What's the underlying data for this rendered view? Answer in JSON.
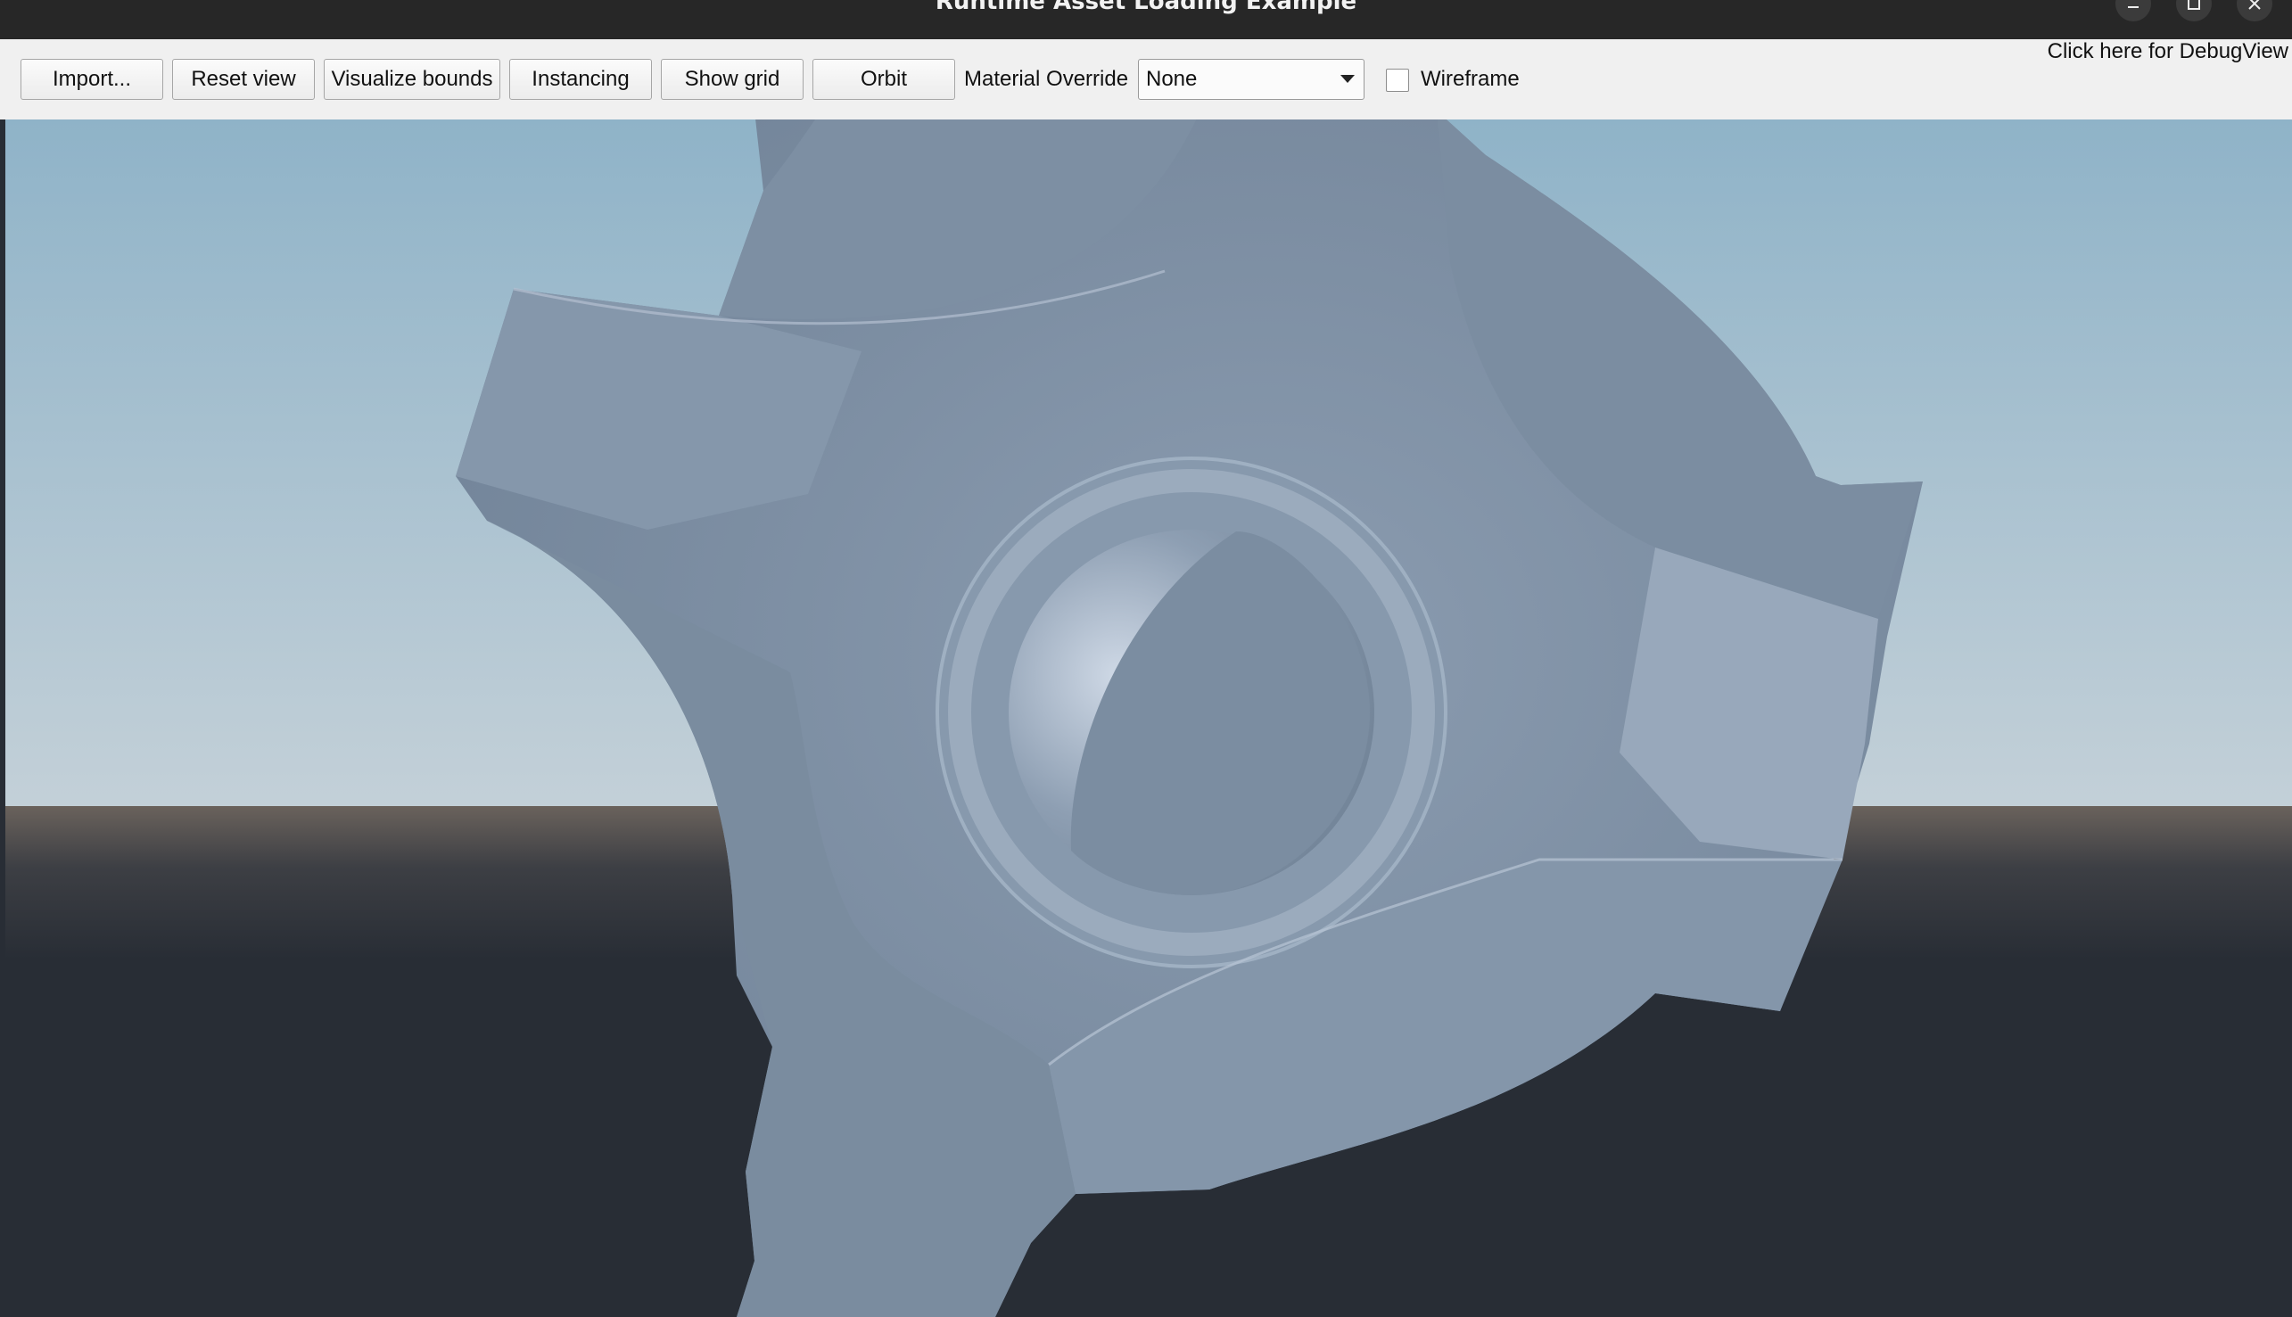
{
  "window": {
    "title": "Runtime Asset Loading Example"
  },
  "titlebar_buttons": {
    "minimize_icon": "minimize-icon",
    "maximize_icon": "maximize-icon",
    "close_icon": "close-icon"
  },
  "toolbar": {
    "import_label": "Import...",
    "reset_view_label": "Reset view",
    "visualize_bounds_label": "Visualize bounds",
    "instancing_label": "Instancing",
    "show_grid_label": "Show grid",
    "orbit_label": "Orbit",
    "material_override_label": "Material Override",
    "material_override_value": "None",
    "wireframe_label": "Wireframe",
    "wireframe_checked": false,
    "debug_link": "Click here for DebugView"
  },
  "viewport": {
    "sky_top_color": "#8fb3c8",
    "sky_horizon_color": "#c3d0d8",
    "ground_color": "#282d35",
    "model_color": "#7c8ea2"
  }
}
